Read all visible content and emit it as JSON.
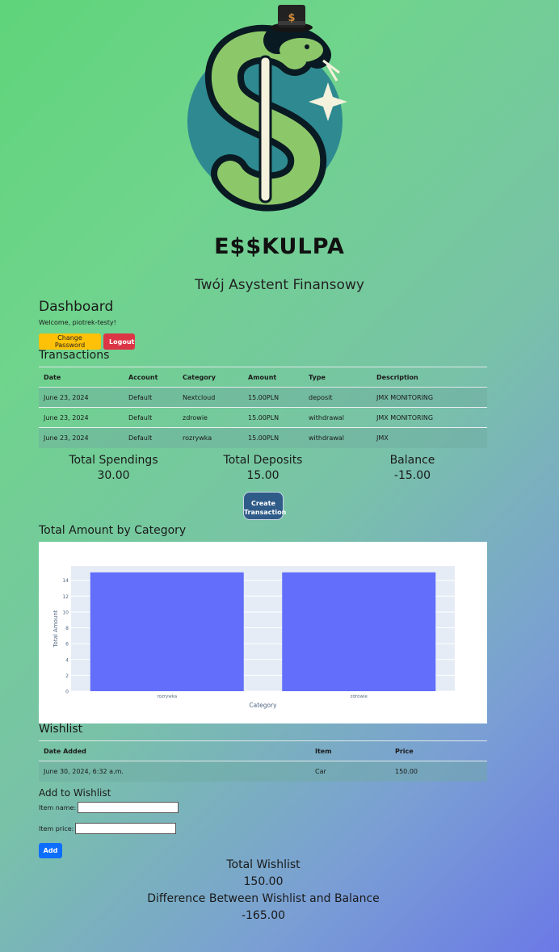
{
  "brand": {
    "name": "E$$KULPA",
    "subtitle": "Twój Asystent Finansowy"
  },
  "dashboard": {
    "title": "Dashboard",
    "welcome": "Welcome, piotrek-testy!",
    "change_password_label": "Change Password",
    "logout_label": "Logout"
  },
  "transactions": {
    "title": "Transactions",
    "columns": [
      "Date",
      "Account",
      "Category",
      "Amount",
      "Type",
      "Description"
    ],
    "rows": [
      [
        "June 23, 2024",
        "Default",
        "Nextcloud",
        "15.00PLN",
        "deposit",
        "JMX MONITORING"
      ],
      [
        "June 23, 2024",
        "Default",
        "zdrowie",
        "15.00PLN",
        "withdrawal",
        "JMX MONITORING"
      ],
      [
        "June 23, 2024",
        "Default",
        "rozrywka",
        "15.00PLN",
        "withdrawal",
        "JMX"
      ]
    ]
  },
  "stats": {
    "spendings_label": "Total Spendings",
    "spendings_value": "30.00",
    "deposits_label": "Total Deposits",
    "deposits_value": "15.00",
    "balance_label": "Balance",
    "balance_value": "-15.00"
  },
  "create_button_line1": "Create",
  "create_button_line2": "Transaction",
  "category_section": {
    "title": "Total Amount by Category"
  },
  "chart_data": {
    "type": "bar",
    "categories": [
      "rozrywka",
      "zdrowie"
    ],
    "values": [
      15,
      15
    ],
    "xlabel": "Category",
    "ylabel": "Total Amount",
    "ylim": [
      0,
      15.8
    ],
    "yticks": [
      0,
      2,
      4,
      6,
      8,
      10,
      12,
      14
    ],
    "bar_color": "#636efa",
    "plot_bg": "#e5ecf6",
    "grid": true
  },
  "wishlist": {
    "title": "Wishlist",
    "columns": [
      "Date Added",
      "Item",
      "Price"
    ],
    "rows": [
      [
        "June 30, 2024, 6:32 a.m.",
        "Car",
        "150.00"
      ]
    ]
  },
  "add_wishlist": {
    "title": "Add to Wishlist",
    "item_name_label": "Item name:",
    "item_price_label": "Item price:",
    "add_label": "Add"
  },
  "totals": {
    "wishlist_label": "Total Wishlist",
    "wishlist_value": "150.00",
    "difference_label": "Difference Between Wishlist and Balance",
    "difference_value": "-165.00"
  },
  "colors": {
    "warning": "#ffc107",
    "danger": "#dc3545",
    "primary": "#0d6efd",
    "create": "#2f5b88"
  }
}
